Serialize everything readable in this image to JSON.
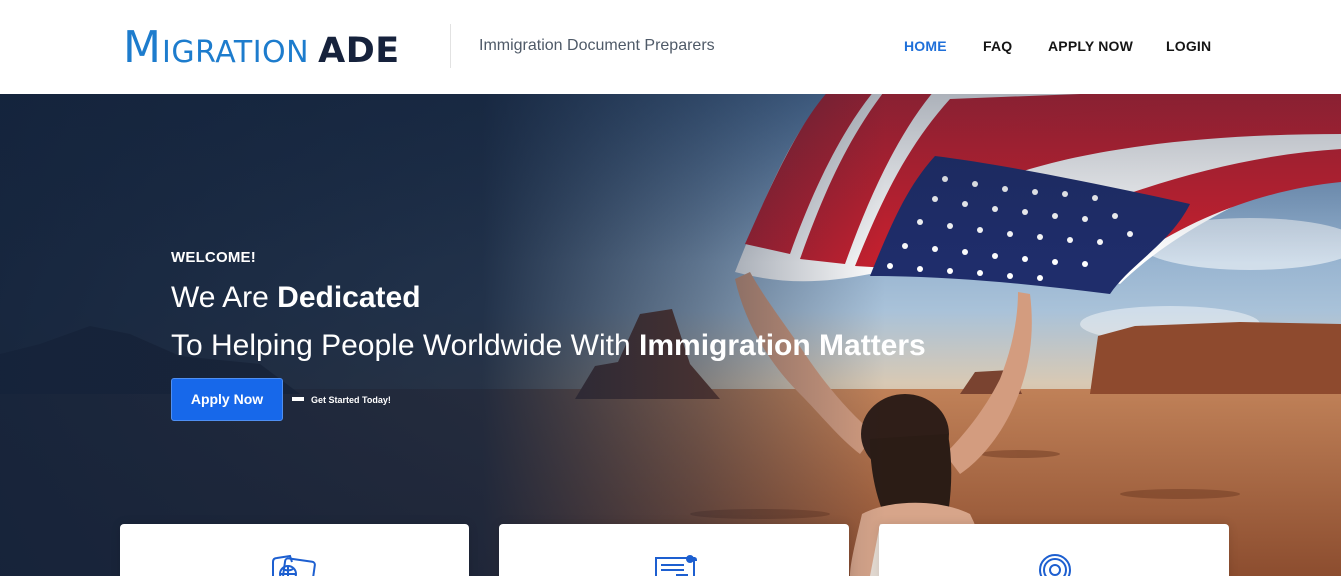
{
  "header": {
    "logo": {
      "first_letter": "M",
      "rest_word": "IGRATION",
      "suffix": "ADE",
      "primary_color": "#1d7ccd",
      "secondary_color": "#16223c"
    },
    "tagline": "Immigration Document Preparers",
    "nav": [
      {
        "label": "HOME",
        "active": true
      },
      {
        "label": "FAQ",
        "active": false
      },
      {
        "label": "APPLY NOW",
        "active": false
      },
      {
        "label": "LOGIN",
        "active": false
      }
    ],
    "active_color": "#1e6fd9"
  },
  "hero": {
    "welcome": "WELCOME!",
    "headline_line1_regular": "We Are ",
    "headline_line1_bold": "Dedicated",
    "headline_line2_regular": "To Helping People Worldwide With ",
    "headline_line2_bold": "Immigration Matters",
    "cta_button": "Apply Now",
    "cta_note": "Get Started Today!",
    "button_color": "#1768ea",
    "background_image": "woman-holding-american-flag-desert"
  },
  "feature_cards": [
    {
      "icon": "passport-globe-icon"
    },
    {
      "icon": "document-certificate-icon"
    },
    {
      "icon": "email-at-icon"
    }
  ]
}
